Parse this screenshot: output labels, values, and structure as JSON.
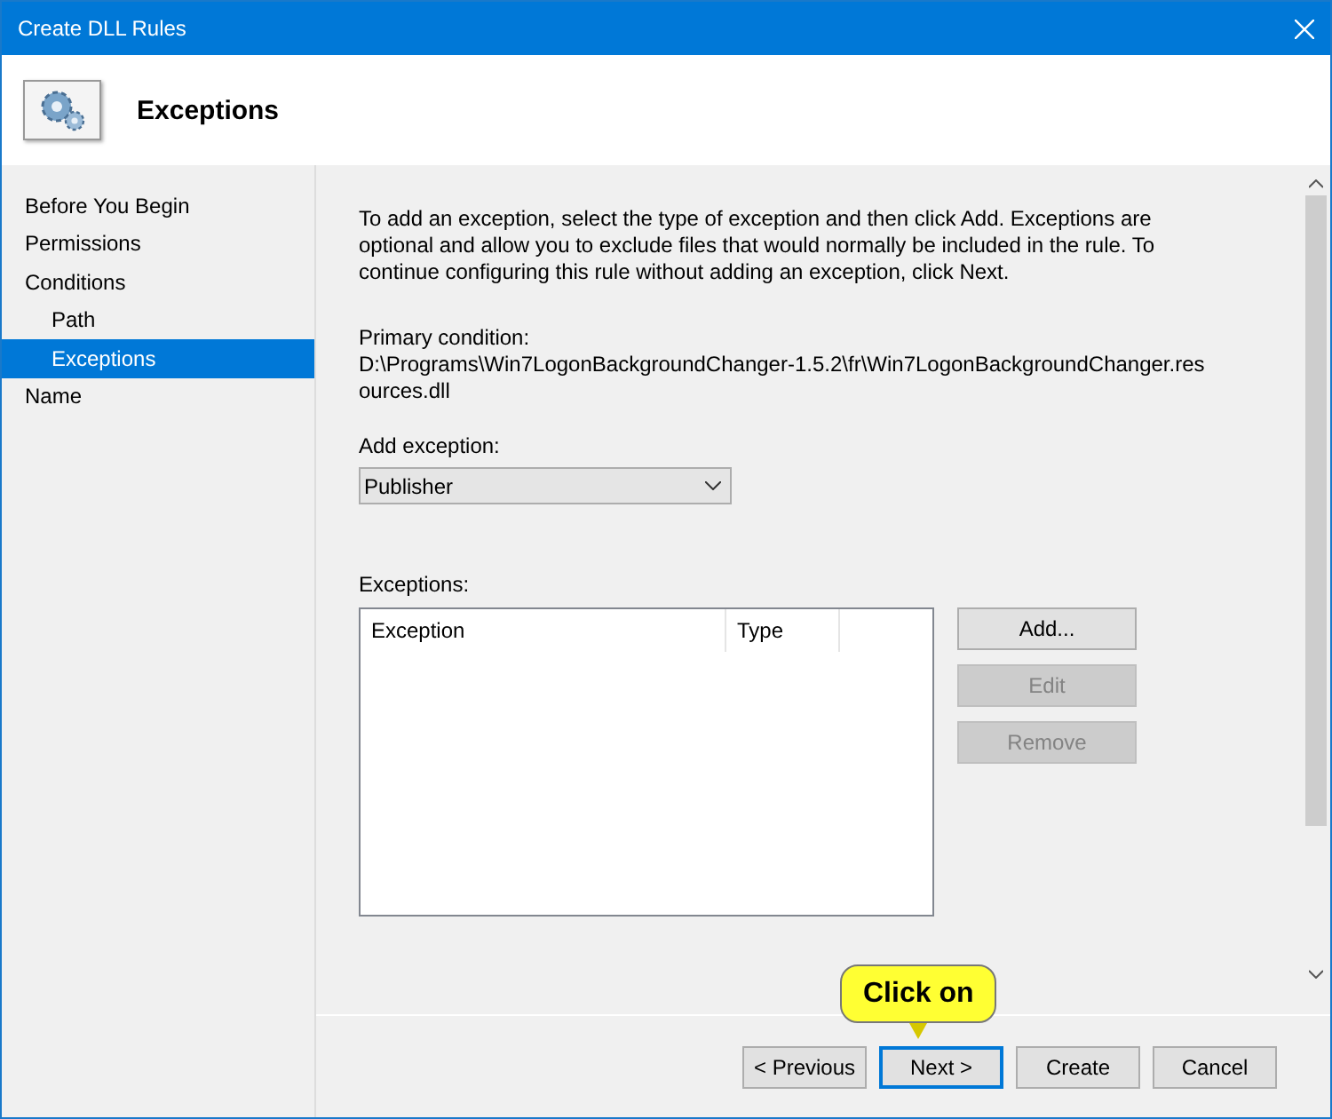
{
  "window": {
    "title": "Create DLL Rules"
  },
  "header": {
    "title": "Exceptions"
  },
  "sidebar": {
    "items": [
      {
        "label": "Before You Begin",
        "selected": false
      },
      {
        "label": "Permissions",
        "selected": false
      },
      {
        "label": "Conditions",
        "selected": false,
        "children": [
          {
            "label": "Path",
            "selected": false
          },
          {
            "label": "Exceptions",
            "selected": true
          }
        ]
      },
      {
        "label": "Name",
        "selected": false
      }
    ]
  },
  "intro": "To add an exception, select the type of exception and then click Add. Exceptions are optional and allow you to exclude files that would normally be included in the rule. To continue configuring this rule without adding an exception, click Next.",
  "primary_condition": {
    "label": "Primary condition:",
    "value_lines": [
      "D:\\Programs\\Win7LogonBackgroundChanger-1.5.2\\fr\\Win7LogonBackgroundChanger.res",
      "ources.dll"
    ]
  },
  "add_exception": {
    "label": "Add exception:",
    "value": "Publisher"
  },
  "exceptions": {
    "label": "Exceptions:",
    "columns": [
      "Exception",
      "Type"
    ],
    "buttons": [
      {
        "label": "Add...",
        "disabled": false
      },
      {
        "label": "Edit",
        "disabled": true
      },
      {
        "label": "Remove",
        "disabled": true
      }
    ]
  },
  "footer_buttons": [
    {
      "label": "< Previous",
      "focused": false
    },
    {
      "label": "Next >",
      "focused": true
    },
    {
      "label": "Create",
      "focused": false
    },
    {
      "label": "Cancel",
      "focused": false
    }
  ],
  "callout": {
    "text": "Click on"
  }
}
